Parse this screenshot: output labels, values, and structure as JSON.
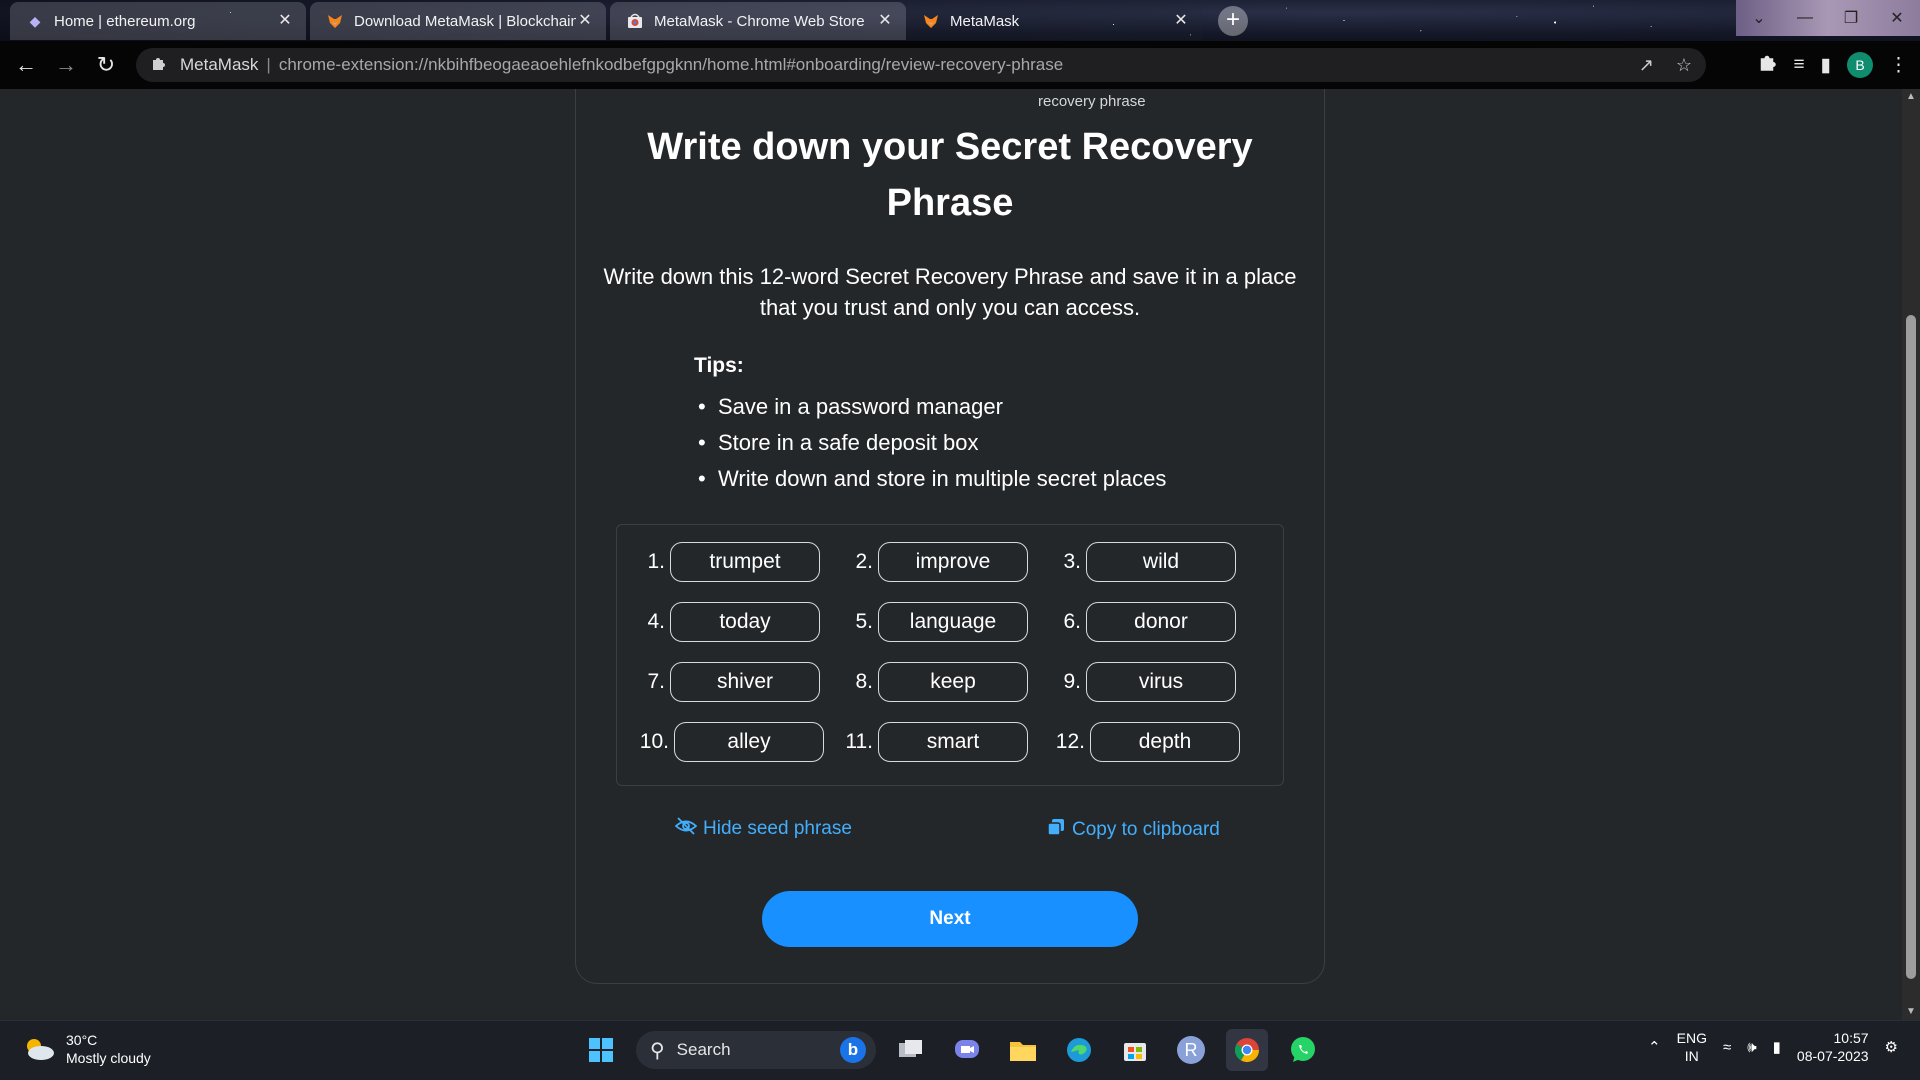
{
  "browser": {
    "tabs": [
      {
        "title": "Home | ethereum.org",
        "favicon": "ethereum-icon"
      },
      {
        "title": "Download MetaMask | Blockchain",
        "favicon": "metamask-fox-icon"
      },
      {
        "title": "MetaMask - Chrome Web Store",
        "favicon": "chrome-web-store-icon"
      },
      {
        "title": "MetaMask",
        "favicon": "metamask-fox-icon"
      }
    ],
    "omnibox": {
      "site": "MetaMask",
      "separator": "|",
      "url": "chrome-extension://nkbihfbeogaeaoehlefnkodbefgpgknn/home.html#onboarding/review-recovery-phrase"
    },
    "profile_initial": "B"
  },
  "page": {
    "crumb": "recovery phrase",
    "title": "Write down your Secret Recovery Phrase",
    "subtitle": "Write down this 12-word Secret Recovery Phrase and save it in a place that you trust and only you can access.",
    "tips_heading": "Tips:",
    "tips": [
      "Save in a password manager",
      "Store in a safe deposit box",
      "Write down and store in multiple secret places"
    ],
    "words": [
      {
        "num": "1.",
        "word": "trumpet"
      },
      {
        "num": "2.",
        "word": "improve"
      },
      {
        "num": "3.",
        "word": "wild"
      },
      {
        "num": "4.",
        "word": "today"
      },
      {
        "num": "5.",
        "word": "language"
      },
      {
        "num": "6.",
        "word": "donor"
      },
      {
        "num": "7.",
        "word": "shiver"
      },
      {
        "num": "8.",
        "word": "keep"
      },
      {
        "num": "9.",
        "word": "virus"
      },
      {
        "num": "10.",
        "word": "alley"
      },
      {
        "num": "11.",
        "word": "smart"
      },
      {
        "num": "12.",
        "word": "depth"
      }
    ],
    "hide_label": "Hide seed phrase",
    "copy_label": "Copy to clipboard",
    "next_label": "Next",
    "accent_color": "#43aefc",
    "button_color": "#1890ff"
  },
  "taskbar": {
    "weather_temp": "30°C",
    "weather_desc": "Mostly cloudy",
    "search_label": "Search",
    "lang_line1": "ENG",
    "lang_line2": "IN",
    "time": "10:57",
    "date": "08-07-2023"
  }
}
